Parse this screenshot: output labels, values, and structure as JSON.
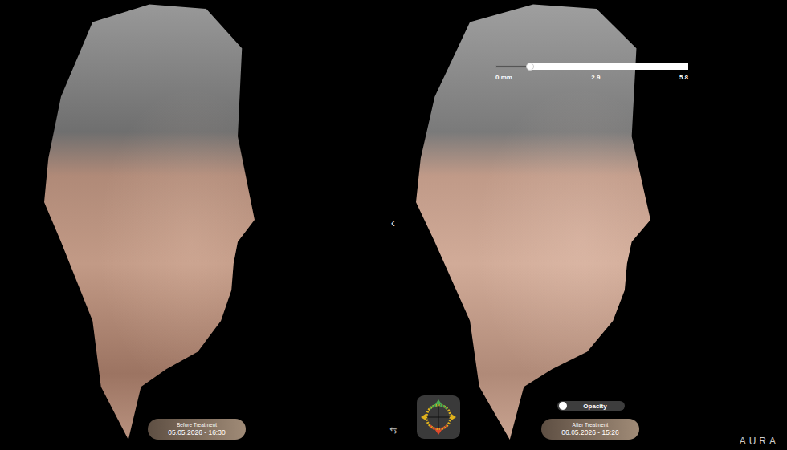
{
  "panels": [
    {
      "label": "Before Treatment",
      "timestamp": "05.05.2026 - 16:30"
    },
    {
      "label": "After Treatment",
      "timestamp": "06.05.2026 - 15:26"
    }
  ],
  "divider": {
    "collapse_glyph": "‹",
    "swap_glyph": "⇆"
  },
  "depth_scale": {
    "min": "0 mm",
    "mid": "2.9",
    "max": "5.8",
    "level": 0.18
  },
  "opacity_toggle": {
    "label": "Opacity",
    "on": false
  },
  "logo": "AURA"
}
